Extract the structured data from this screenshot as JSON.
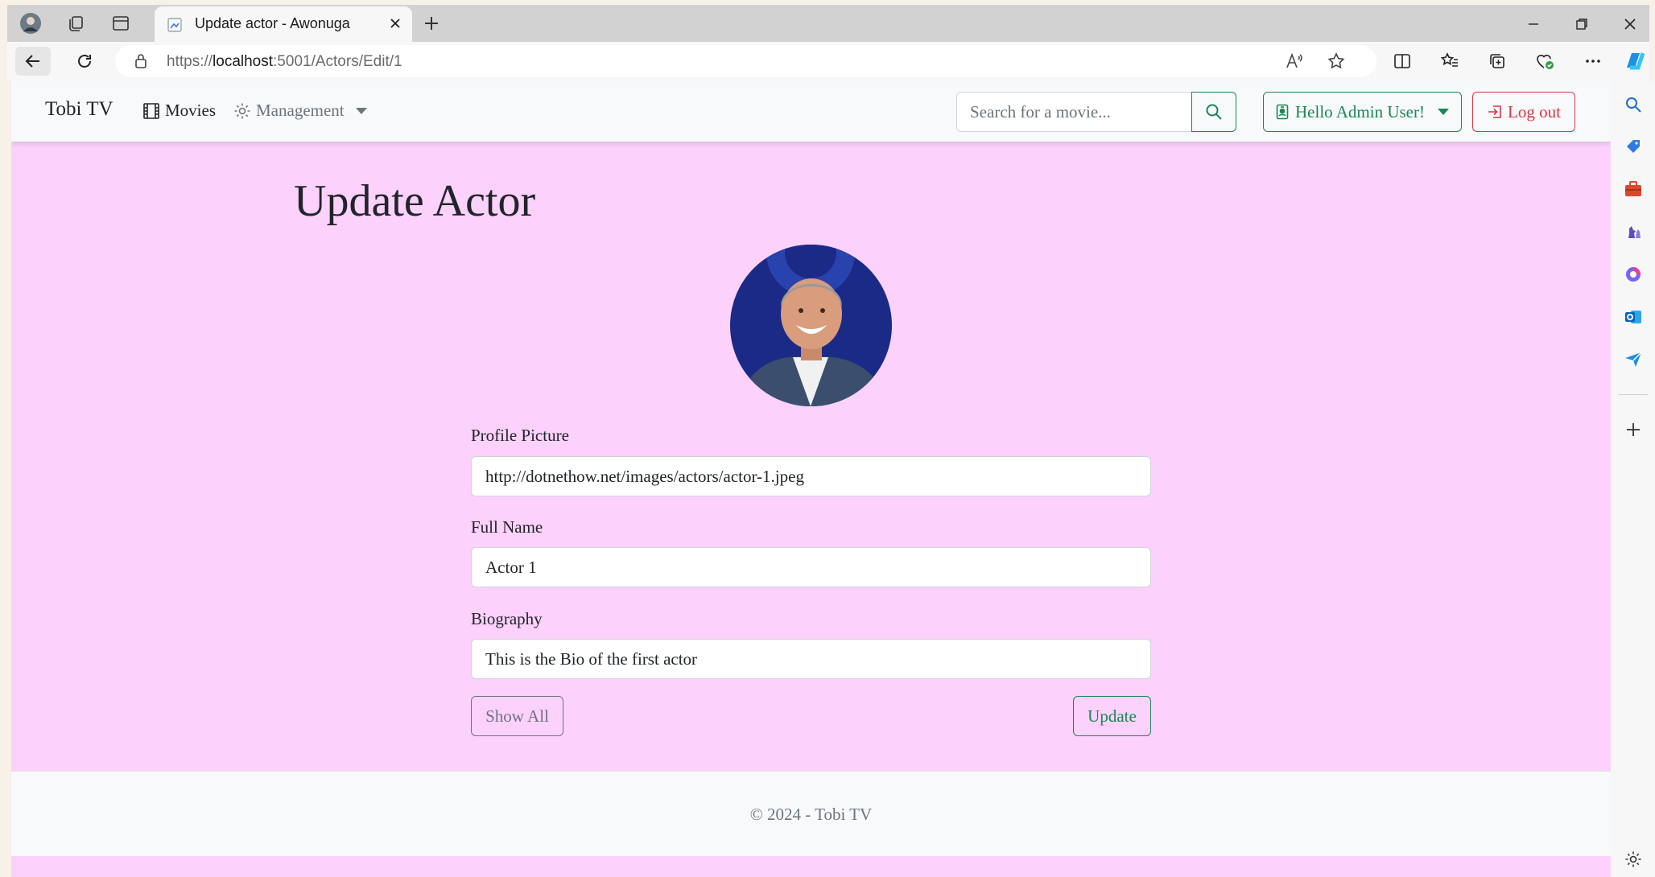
{
  "browser": {
    "tab_title": "Update actor - Awonuga",
    "url_prefix": "https://",
    "url_host": "localhost",
    "url_rest": ":5001/Actors/Edit/1"
  },
  "navbar": {
    "brand": "Tobi TV",
    "movies": "Movies",
    "management": "Management",
    "search_placeholder": "Search for a movie...",
    "user_greeting": "Hello Admin User!",
    "logout": "Log out"
  },
  "page": {
    "title": "Update Actor"
  },
  "form": {
    "profile_picture_label": "Profile Picture",
    "profile_picture_value": "http://dotnethow.net/images/actors/actor-1.jpeg",
    "full_name_label": "Full Name",
    "full_name_value": "Actor 1",
    "biography_label": "Biography",
    "biography_value": "This is the Bio of the first actor",
    "show_all": "Show All",
    "update": "Update"
  },
  "footer": {
    "text": "© 2024 - Tobi TV"
  },
  "colors": {
    "page_background": "#fcd1fc",
    "success": "#198754",
    "danger": "#dc3545",
    "secondary": "#6c757d"
  }
}
